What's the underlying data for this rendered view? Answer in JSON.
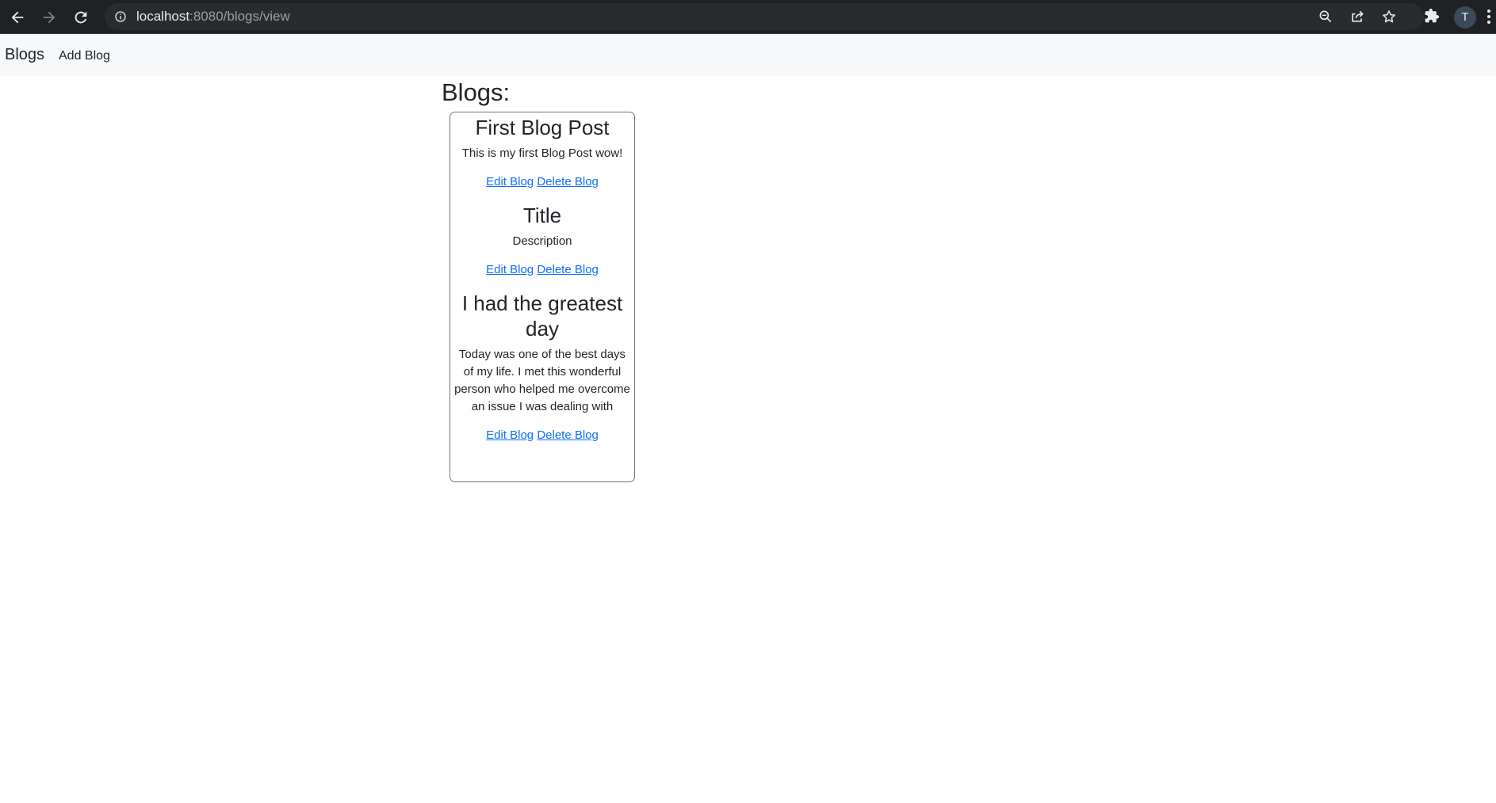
{
  "browser": {
    "url_host": "localhost",
    "url_rest": ":8080/blogs/view",
    "profile_initial": "T"
  },
  "navbar": {
    "brand": "Blogs",
    "links": [
      {
        "label": "Add Blog"
      }
    ]
  },
  "main": {
    "heading": "Blogs:",
    "posts": [
      {
        "title": "First Blog Post",
        "description": "This is my first Blog Post wow!",
        "edit_label": "Edit Blog",
        "delete_label": "Delete Blog"
      },
      {
        "title": "Title",
        "description": "Description",
        "edit_label": "Edit Blog",
        "delete_label": "Delete Blog"
      },
      {
        "title": "I had the greatest day",
        "description": "Today was one of the best days of my life. I met this wonderful person who helped me overcome an issue I was dealing with",
        "edit_label": "Edit Blog",
        "delete_label": "Delete Blog"
      }
    ]
  },
  "colors": {
    "chrome_bg": "#202124",
    "navbar_bg": "#f8f9fa",
    "link": "#0d6efd",
    "text": "#212529",
    "card_border": "#6c757d"
  },
  "icons": {
    "back": "arrow-left-icon",
    "forward": "arrow-right-icon",
    "reload": "reload-icon",
    "info": "info-icon",
    "zoom": "zoom-icon",
    "share": "share-icon",
    "bookmark": "star-icon",
    "extensions": "puzzle-icon",
    "menu": "kebab-menu-icon"
  }
}
